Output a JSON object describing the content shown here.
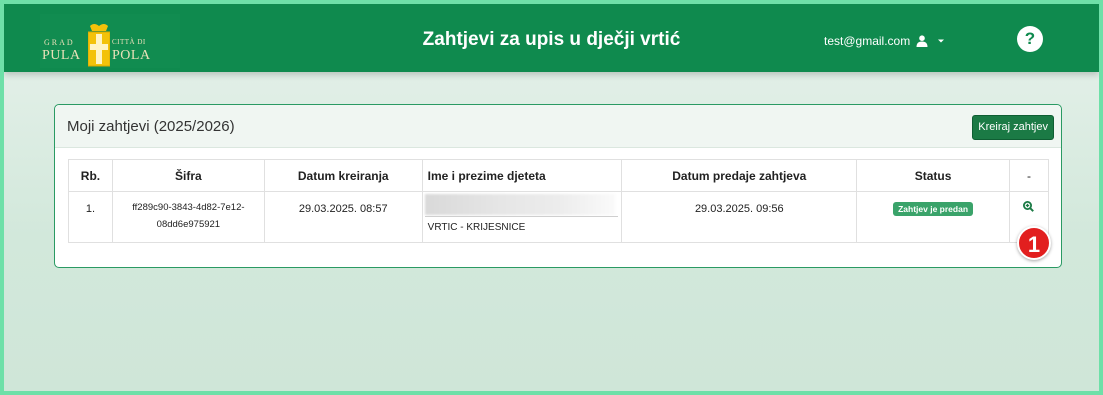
{
  "header": {
    "logo": {
      "left_small": "GRAD",
      "left_big": "PULA",
      "right_small": "CITTÀ DI",
      "right_big": "POLA"
    },
    "title": "Zahtjevi za upis u dječji vrtić",
    "user_email": "test@gmail.com",
    "help_label": "?"
  },
  "card": {
    "title": "Moji zahtjevi (2025/2026)",
    "create_button": "Kreiraj zahtjev"
  },
  "table": {
    "columns": [
      "Rb.",
      "Šifra",
      "Datum kreiranja",
      "Ime i prezime djeteta",
      "Datum predaje zahtjeva",
      "Status",
      "-"
    ],
    "rows": [
      {
        "rb": "1.",
        "sifra_line1": "ff289c90-3843-4d82-7e12-",
        "sifra_line2": "08dd6e975921",
        "datum_kreiranja": "29.03.2025. 08:57",
        "vrtic": "VRTIC - KRIJESNICE",
        "datum_predaje": "29.03.2025. 09:56",
        "status": "Zahtjev je predan"
      }
    ]
  },
  "annotation": {
    "marker": "1"
  },
  "colors": {
    "brand_green": "#0f8a4e",
    "badge_green": "#3aa36a",
    "marker_red": "#e21f1f"
  }
}
